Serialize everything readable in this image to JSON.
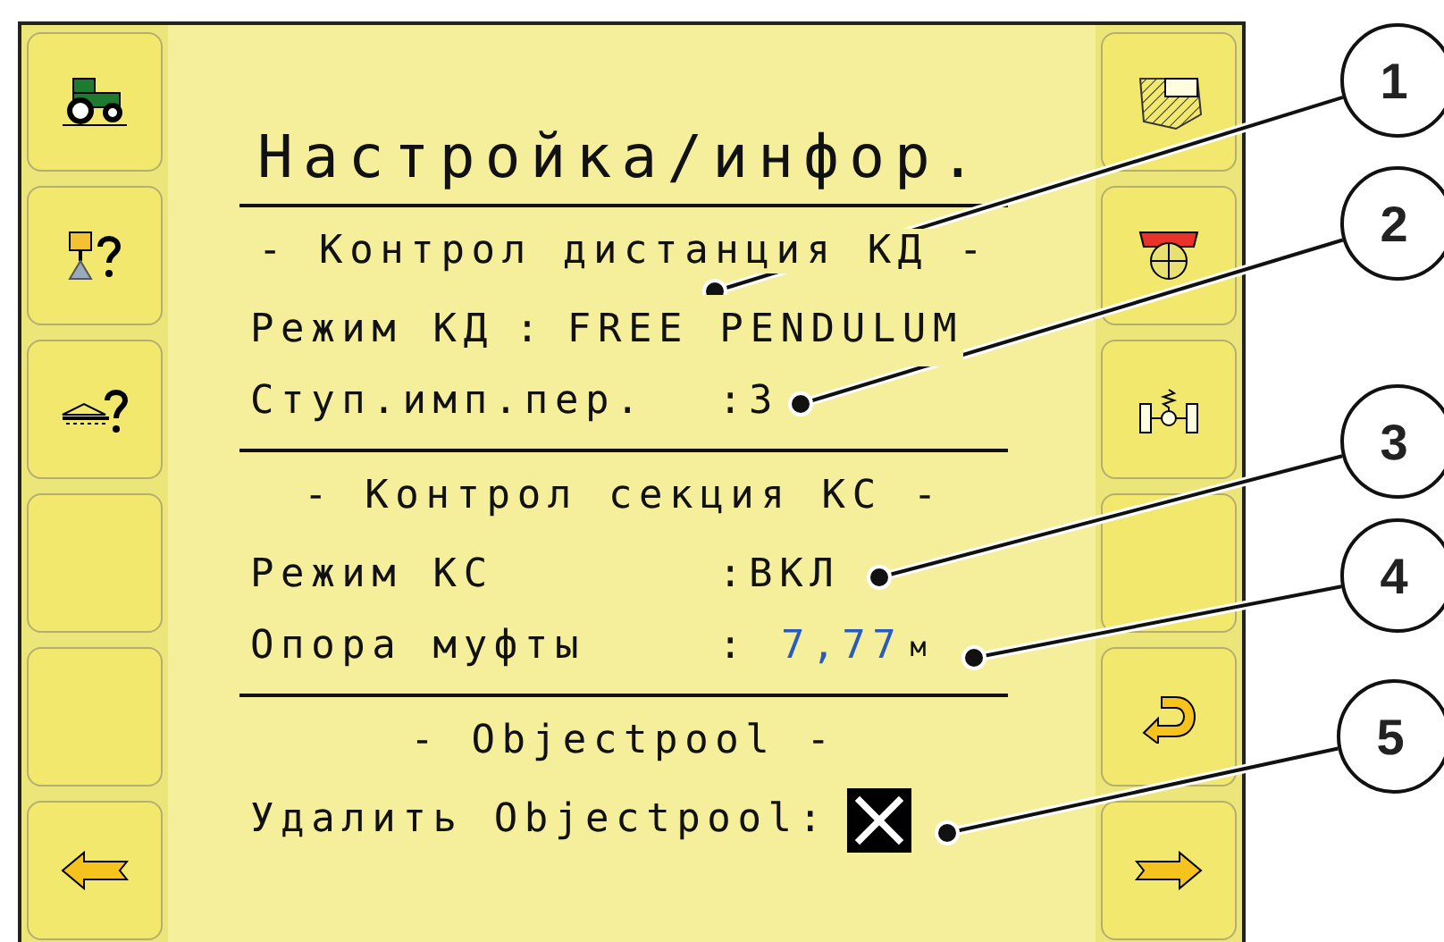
{
  "title": "Настройка/инфор.",
  "sections": [
    {
      "heading": "- Контрол дистанция КД -",
      "rows": [
        {
          "kind": "inline",
          "label": "Режим КД",
          "separator": ":",
          "value": "FREE PENDULUM"
        },
        {
          "kind": "column",
          "label": "Ступ.имп.пер.",
          "separator": ":",
          "value": "3"
        }
      ]
    },
    {
      "heading": "- Контрол секция КС -",
      "rows": [
        {
          "kind": "column",
          "label": "Режим КС",
          "separator": ":",
          "value": "ВКЛ"
        },
        {
          "kind": "measure",
          "label": "Опора муфты",
          "separator": ":",
          "value": "7,77",
          "unit": "м"
        }
      ]
    },
    {
      "heading": "- Objectpool -",
      "rows": [
        {
          "kind": "checkbox",
          "label": "Удалить Objectpool:",
          "checked": true
        }
      ]
    }
  ],
  "callouts": [
    "1",
    "2",
    "3",
    "4",
    "5"
  ]
}
